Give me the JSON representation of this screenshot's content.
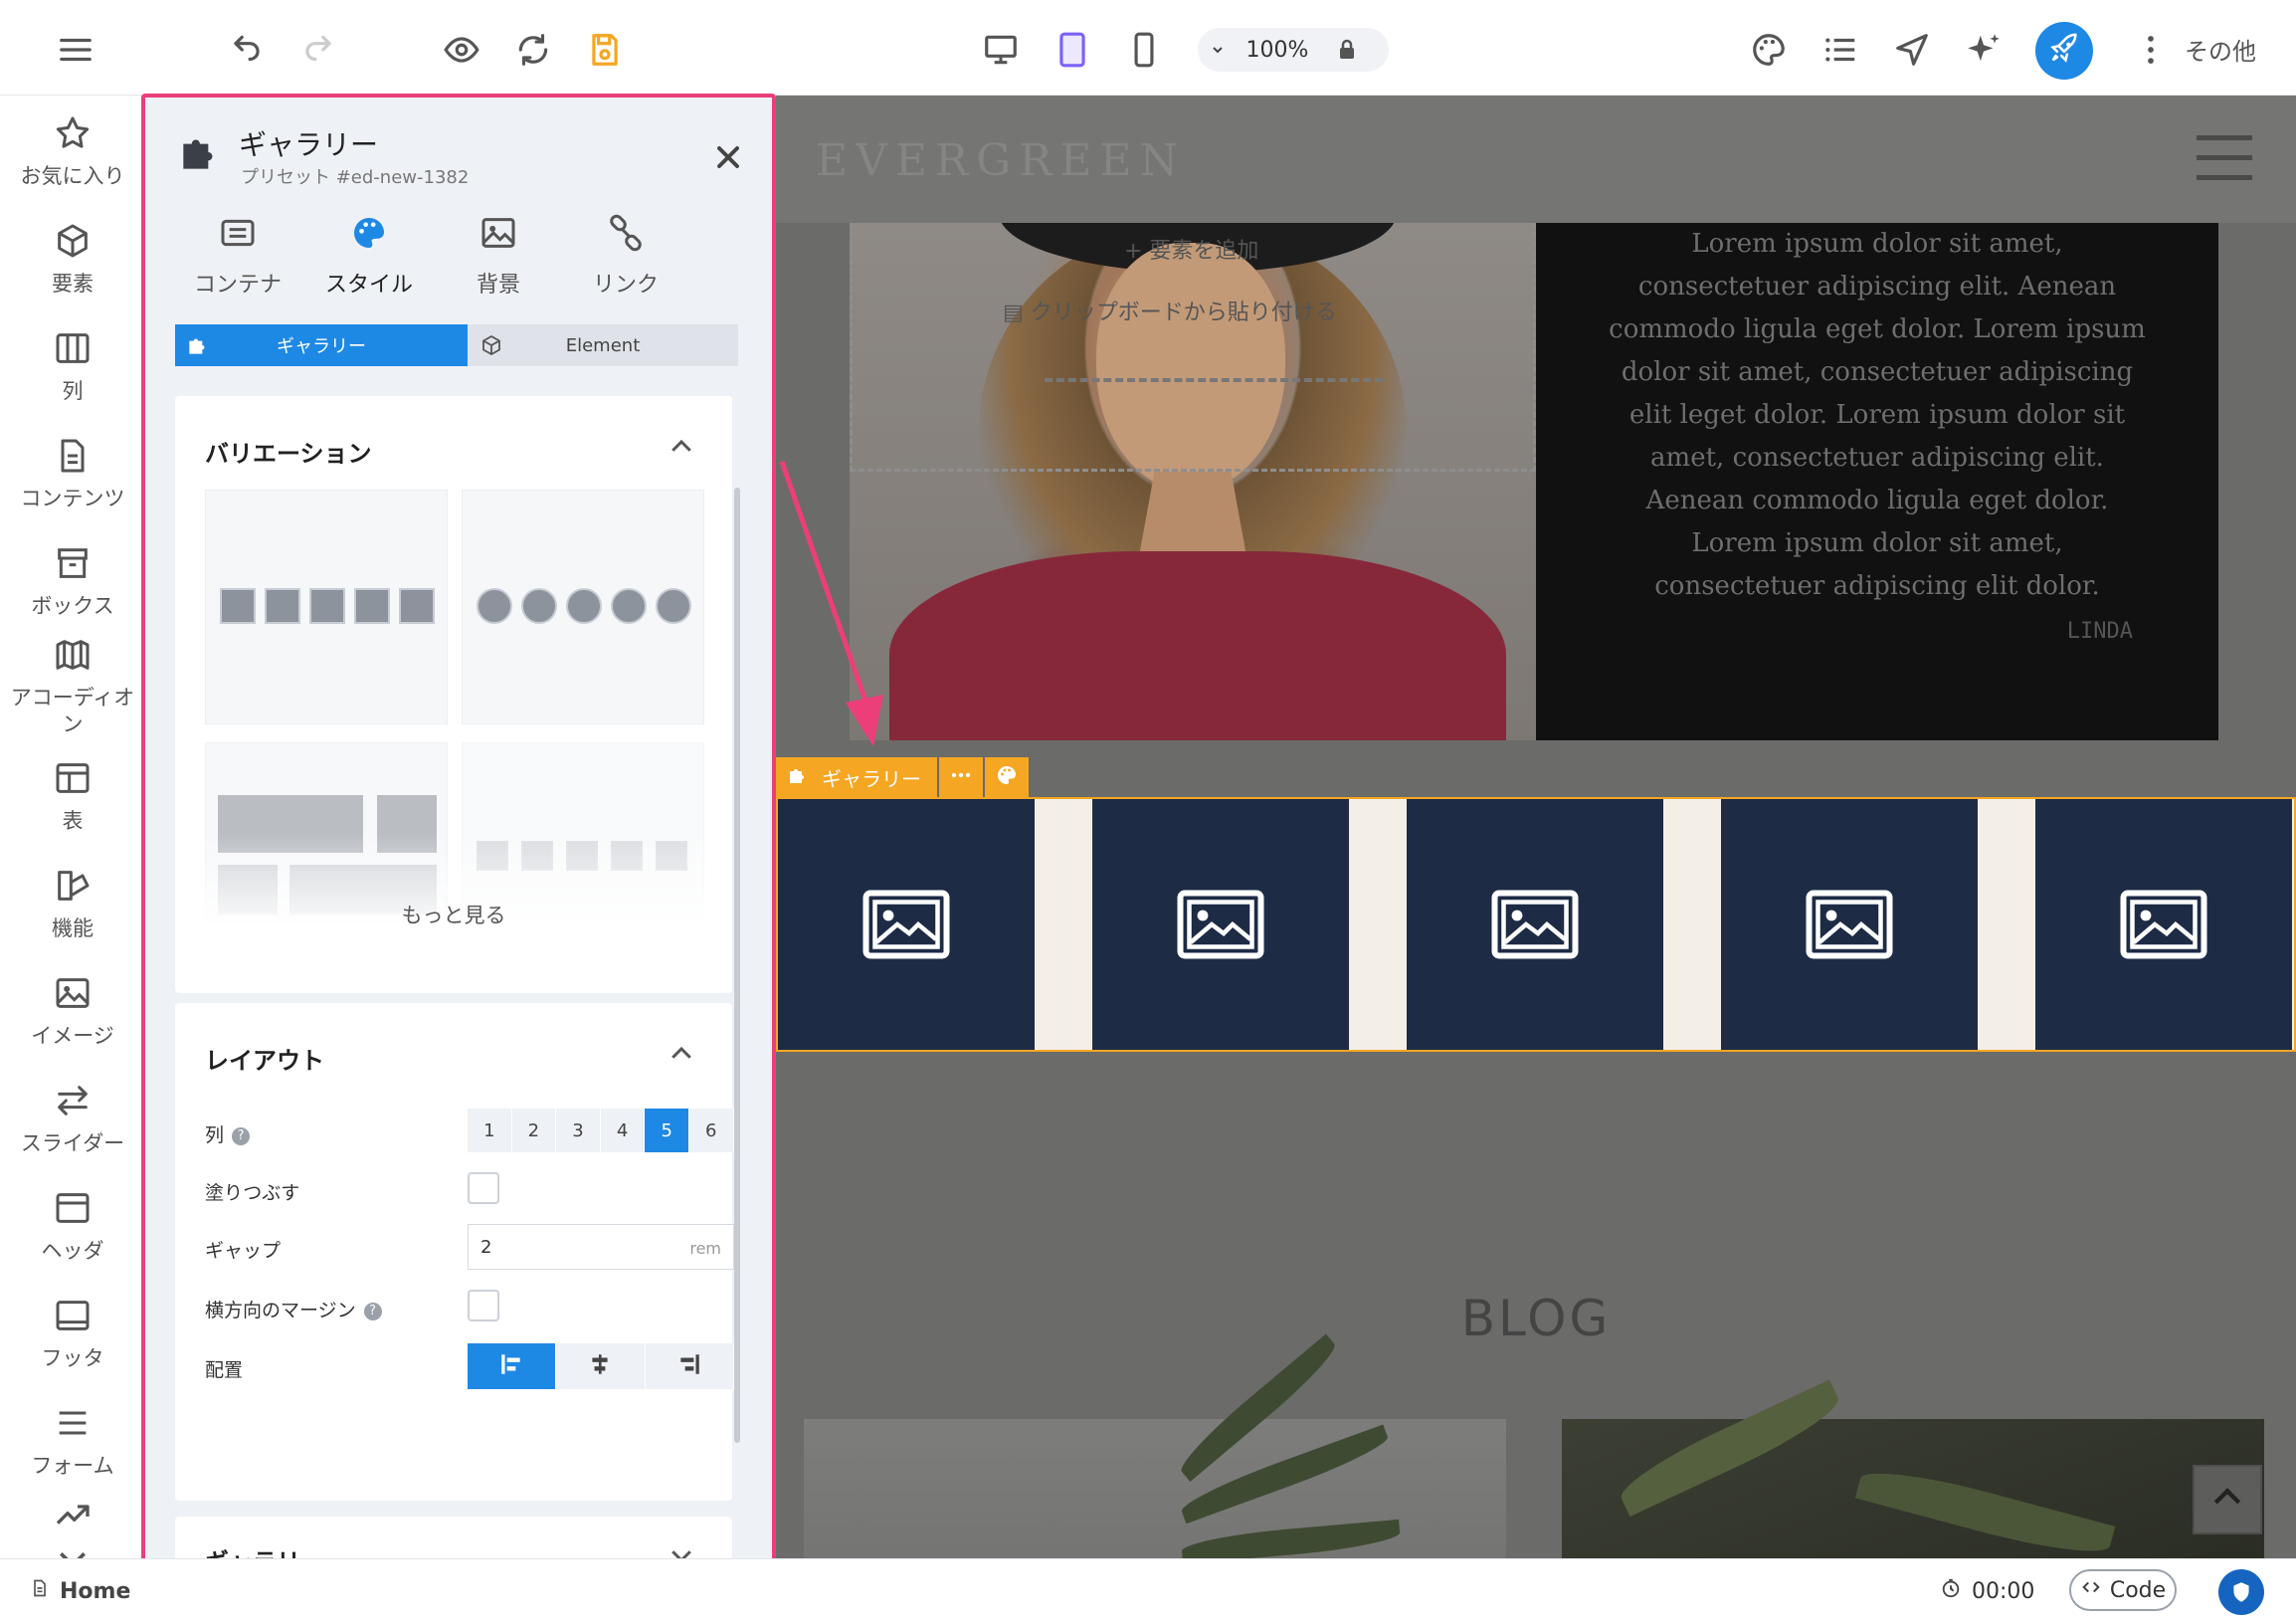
{
  "toolbar": {
    "zoom": "100%",
    "more_label": "その他",
    "icons": [
      "menu-icon",
      "undo-icon",
      "redo-icon",
      "preview-icon",
      "refresh-icon",
      "save-icon",
      "desktop-icon",
      "tablet-icon",
      "mobile-icon",
      "lock-icon",
      "palette-icon",
      "list-icon",
      "navigate-icon",
      "ai-sparkle-icon",
      "rocket-icon",
      "kebab-icon"
    ],
    "accent": "#1e88e5",
    "save_color": "#f5a623"
  },
  "rail": {
    "items": [
      {
        "label": "お気に入り",
        "icon": "star-icon"
      },
      {
        "label": "要素",
        "icon": "cube-icon"
      },
      {
        "label": "列",
        "icon": "columns-icon"
      },
      {
        "label": "コンテンツ",
        "icon": "document-icon"
      },
      {
        "label": "ボックス",
        "icon": "box-icon"
      },
      {
        "label": "アコーディオン",
        "icon": "accordion-icon"
      },
      {
        "label": "表",
        "icon": "table-icon"
      },
      {
        "label": "機能",
        "icon": "features-icon"
      },
      {
        "label": "イメージ",
        "icon": "image-icon"
      },
      {
        "label": "スライダー",
        "icon": "slider-icon"
      },
      {
        "label": "ヘッダ",
        "icon": "header-icon"
      },
      {
        "label": "フッタ",
        "icon": "footer-icon"
      },
      {
        "label": "フォーム",
        "icon": "form-icon"
      }
    ]
  },
  "panel": {
    "title": "ギャラリー",
    "subtitle": "プリセット #ed-new-1382",
    "tabs": [
      {
        "label": "コンテナ",
        "icon": "container-icon"
      },
      {
        "label": "スタイル",
        "icon": "palette-icon"
      },
      {
        "label": "背景",
        "icon": "background-image-icon"
      },
      {
        "label": "リンク",
        "icon": "link-icon"
      }
    ],
    "segment": {
      "active": "ギャラリー",
      "other": "Element"
    },
    "variation": {
      "title": "バリエーション",
      "more": "もっと見る"
    },
    "layout": {
      "title": "レイアウト",
      "columns_label": "列",
      "columns": [
        "1",
        "2",
        "3",
        "4",
        "5",
        "6"
      ],
      "columns_selected": "5",
      "fill_label": "塗りつぶす",
      "fill_checked": false,
      "gap_label": "ギャップ",
      "gap_value": "2",
      "gap_unit": "rem",
      "hmargin_label": "横方向のマージン",
      "hmargin_checked": false,
      "align_label": "配置",
      "align_selected": "left"
    },
    "gallery_section": {
      "title": "ギャラリー"
    },
    "border_color": "#ec3f7a"
  },
  "canvas": {
    "logo": "EVERGREEN",
    "add_element": "+ 要素を追加",
    "paste_clipboard": "クリップボードから貼り付ける",
    "quote": "Lorem ipsum dolor sit amet, consectetuer adipiscing elit. Aenean commodo ligula eget dolor. Lorem ipsum dolor sit amet, consectetuer adipiscing elit leget dolor. Lorem ipsum dolor sit amet, consectetuer adipiscing elit. Aenean commodo ligula eget dolor. Lorem ipsum dolor sit amet, consectetuer adipiscing elit dolor.",
    "quote_signature": "LINDA",
    "selected_label": "ギャラリー",
    "gallery_tiles": 5,
    "blog_title": "BLOG",
    "gallery_tile_color": "#1d2b45",
    "selection_color": "#f5a623"
  },
  "statusbar": {
    "page": "Home",
    "timer": "00:00",
    "code": "Code"
  }
}
